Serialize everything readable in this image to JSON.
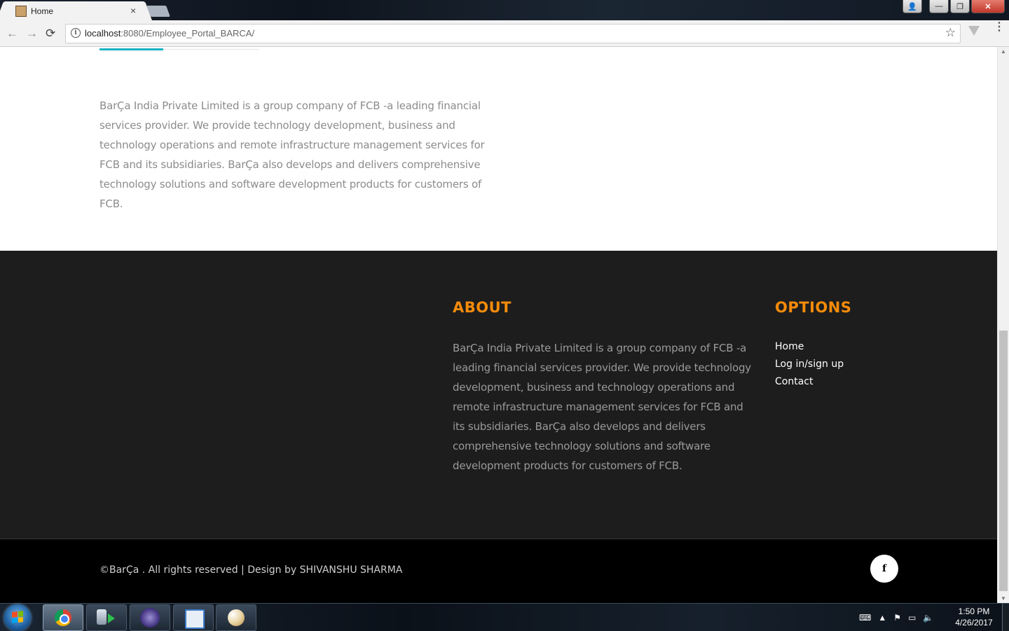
{
  "browser": {
    "tab_title": "Home",
    "tab_close": "×",
    "url_host": "localhost",
    "url_path": ":8080/Employee_Portal_BARCA/",
    "back_glyph": "←",
    "forward_glyph": "→",
    "reload_glyph": "⟳",
    "star_glyph": "☆",
    "menu_glyph": "⋮"
  },
  "window": {
    "minimize": "—",
    "maximize": "❐",
    "close": "✕"
  },
  "intro": {
    "text": "BarÇa India Private Limited is a group company of FCB -a leading financial services provider. We provide technology development, business and technology operations and remote infrastructure management services for FCB and its subsidiaries. BarÇa also develops and delivers comprehensive technology solutions and software development products for customers of FCB."
  },
  "footer": {
    "about_heading": "ABOUT",
    "about_text": "BarÇa India Private Limited is a group company of FCB -a leading financial services provider. We provide technology development, business and technology operations and remote infrastructure management services for FCB and its subsidiaries. BarÇa also develops and delivers comprehensive technology solutions and software development products for customers of FCB.",
    "options_heading": "OPTIONS",
    "options": [
      "Home",
      "Log in/sign up",
      "Contact"
    ]
  },
  "bottom": {
    "copyright": "©BarÇa . All rights reserved | Design by SHIVANSHU SHARMA",
    "social_letter": "f"
  },
  "taskbar": {
    "time": "1:50 PM",
    "date": "4/26/2017",
    "apps": [
      "chrome-icon",
      "database-icon",
      "eclipse-icon",
      "presentation-icon",
      "paint-icon"
    ]
  },
  "colors": {
    "accent_orange": "#f58b0a",
    "accent_teal": "#1ab3c4",
    "footer_bg": "#1d1d1d"
  }
}
